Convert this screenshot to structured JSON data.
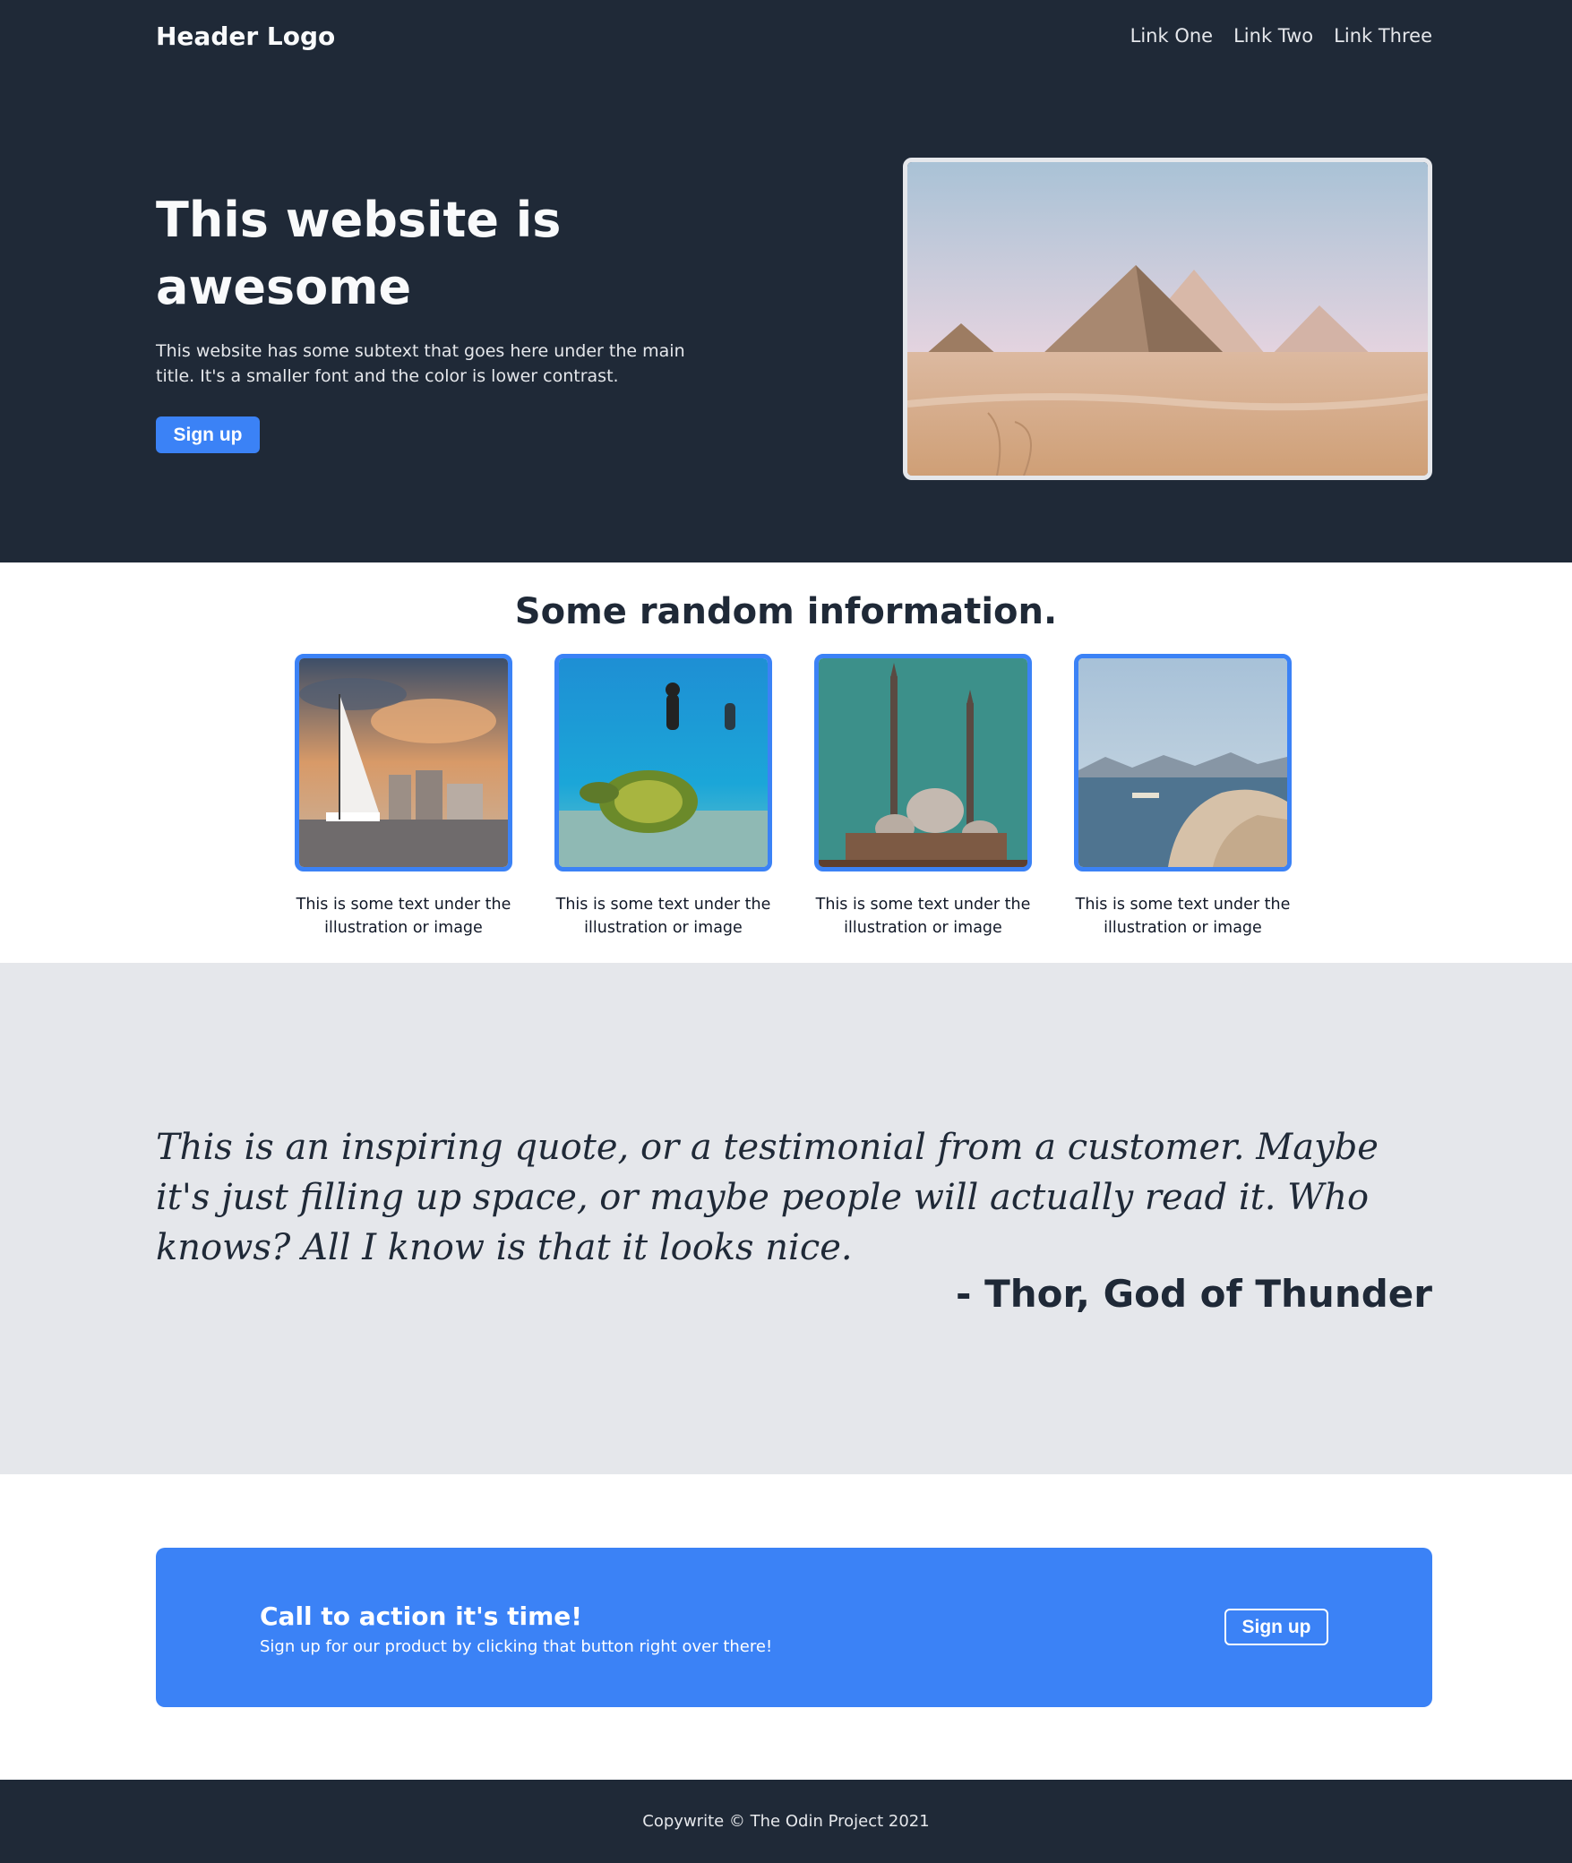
{
  "header": {
    "logo": "Header Logo",
    "nav": [
      "Link One",
      "Link Two",
      "Link Three"
    ]
  },
  "hero": {
    "title": "This website is awesome",
    "subtext": "This website has some subtext that goes here under the main title. It's a smaller font and the color is lower contrast.",
    "button_label": "Sign up",
    "image_icon": "pyramids-image"
  },
  "info": {
    "title": "Some random information.",
    "cards": [
      {
        "caption": "This is some text under the illustration or image",
        "image_icon": "sailboat-city-image"
      },
      {
        "caption": "This is some text under the illustration or image",
        "image_icon": "diver-turtle-image"
      },
      {
        "caption": "This is some text under the illustration or image",
        "image_icon": "mosque-image"
      },
      {
        "caption": "This is some text under the illustration or image",
        "image_icon": "coast-image"
      }
    ]
  },
  "quote": {
    "text": "This is an inspiring quote, or a testimonial from a customer. Maybe it's just filling up space, or maybe people will actually read it. Who knows? All I know is that it looks nice.",
    "author": "- Thor, God of Thunder"
  },
  "cta": {
    "title": "Call to action it's time!",
    "subtext": "Sign up for our product by clicking that button right over there!",
    "button_label": "Sign up"
  },
  "footer": {
    "text": "Copywrite © The Odin Project 2021"
  },
  "colors": {
    "dark": "#1f2937",
    "accent": "#3b82f6",
    "light_gray": "#e5e7eb"
  }
}
